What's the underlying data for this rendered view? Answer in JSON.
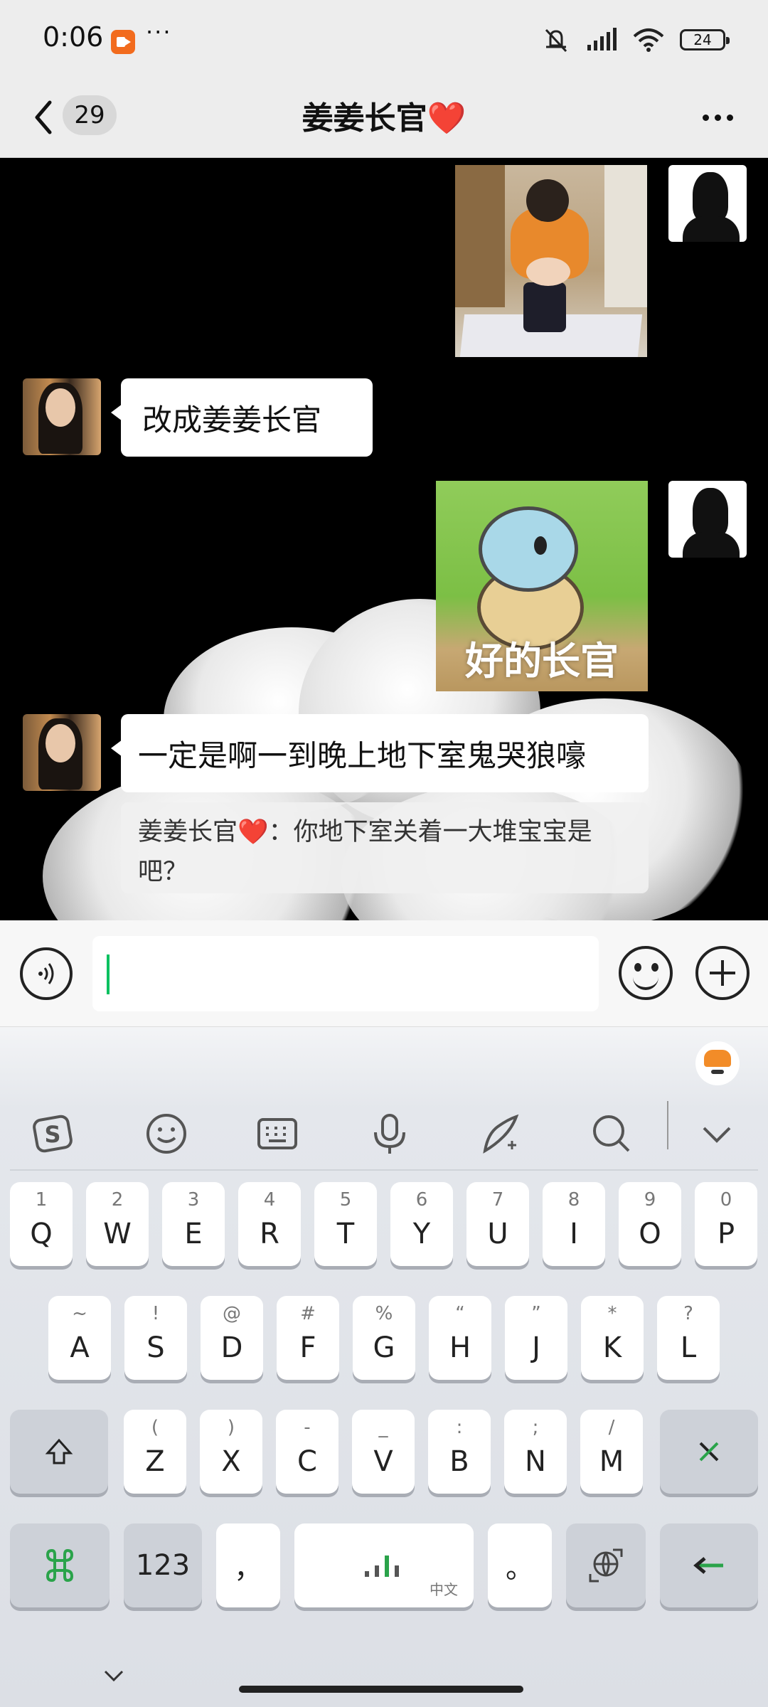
{
  "status_bar": {
    "time": "0:06",
    "battery": "24"
  },
  "header": {
    "unread_count": "29",
    "title": "姜姜长官",
    "title_heart": "❤️"
  },
  "messages": [
    {
      "sender": "self",
      "type": "image",
      "content": "baby photo"
    },
    {
      "sender": "other",
      "type": "text",
      "text": "改成姜姜长官"
    },
    {
      "sender": "self",
      "type": "sticker",
      "caption": "好的长官"
    },
    {
      "sender": "other",
      "type": "text",
      "text": "一定是啊一到晚上地下室鬼哭狼嚎"
    }
  ],
  "quote": {
    "author": "姜姜长官",
    "heart": "❤️",
    "separator": "：",
    "text": "你地下室关着一大堆宝宝是吧？"
  },
  "keyboard": {
    "row1": [
      {
        "main": "Q",
        "sub": "1"
      },
      {
        "main": "W",
        "sub": "2"
      },
      {
        "main": "E",
        "sub": "3"
      },
      {
        "main": "R",
        "sub": "4"
      },
      {
        "main": "T",
        "sub": "5"
      },
      {
        "main": "Y",
        "sub": "6"
      },
      {
        "main": "U",
        "sub": "7"
      },
      {
        "main": "I",
        "sub": "8"
      },
      {
        "main": "O",
        "sub": "9"
      },
      {
        "main": "P",
        "sub": "0"
      }
    ],
    "row2": [
      {
        "main": "A",
        "sub": "~"
      },
      {
        "main": "S",
        "sub": "!"
      },
      {
        "main": "D",
        "sub": "@"
      },
      {
        "main": "F",
        "sub": "#"
      },
      {
        "main": "G",
        "sub": "%"
      },
      {
        "main": "H",
        "sub": "“"
      },
      {
        "main": "J",
        "sub": "”"
      },
      {
        "main": "K",
        "sub": "*"
      },
      {
        "main": "L",
        "sub": "?"
      }
    ],
    "row3": [
      {
        "main": "Z",
        "sub": "("
      },
      {
        "main": "X",
        "sub": ")"
      },
      {
        "main": "C",
        "sub": "-"
      },
      {
        "main": "V",
        "sub": "_"
      },
      {
        "main": "B",
        "sub": ":"
      },
      {
        "main": "N",
        "sub": ";"
      },
      {
        "main": "M",
        "sub": "/"
      }
    ],
    "numbers_key": "123",
    "comma_key": "，",
    "period_key": "。",
    "space_sub": "中文"
  },
  "colors": {
    "accent_green": "#07c160",
    "chat_bg": "#000000",
    "header_bg": "#ededed",
    "heart": "#e53935"
  }
}
